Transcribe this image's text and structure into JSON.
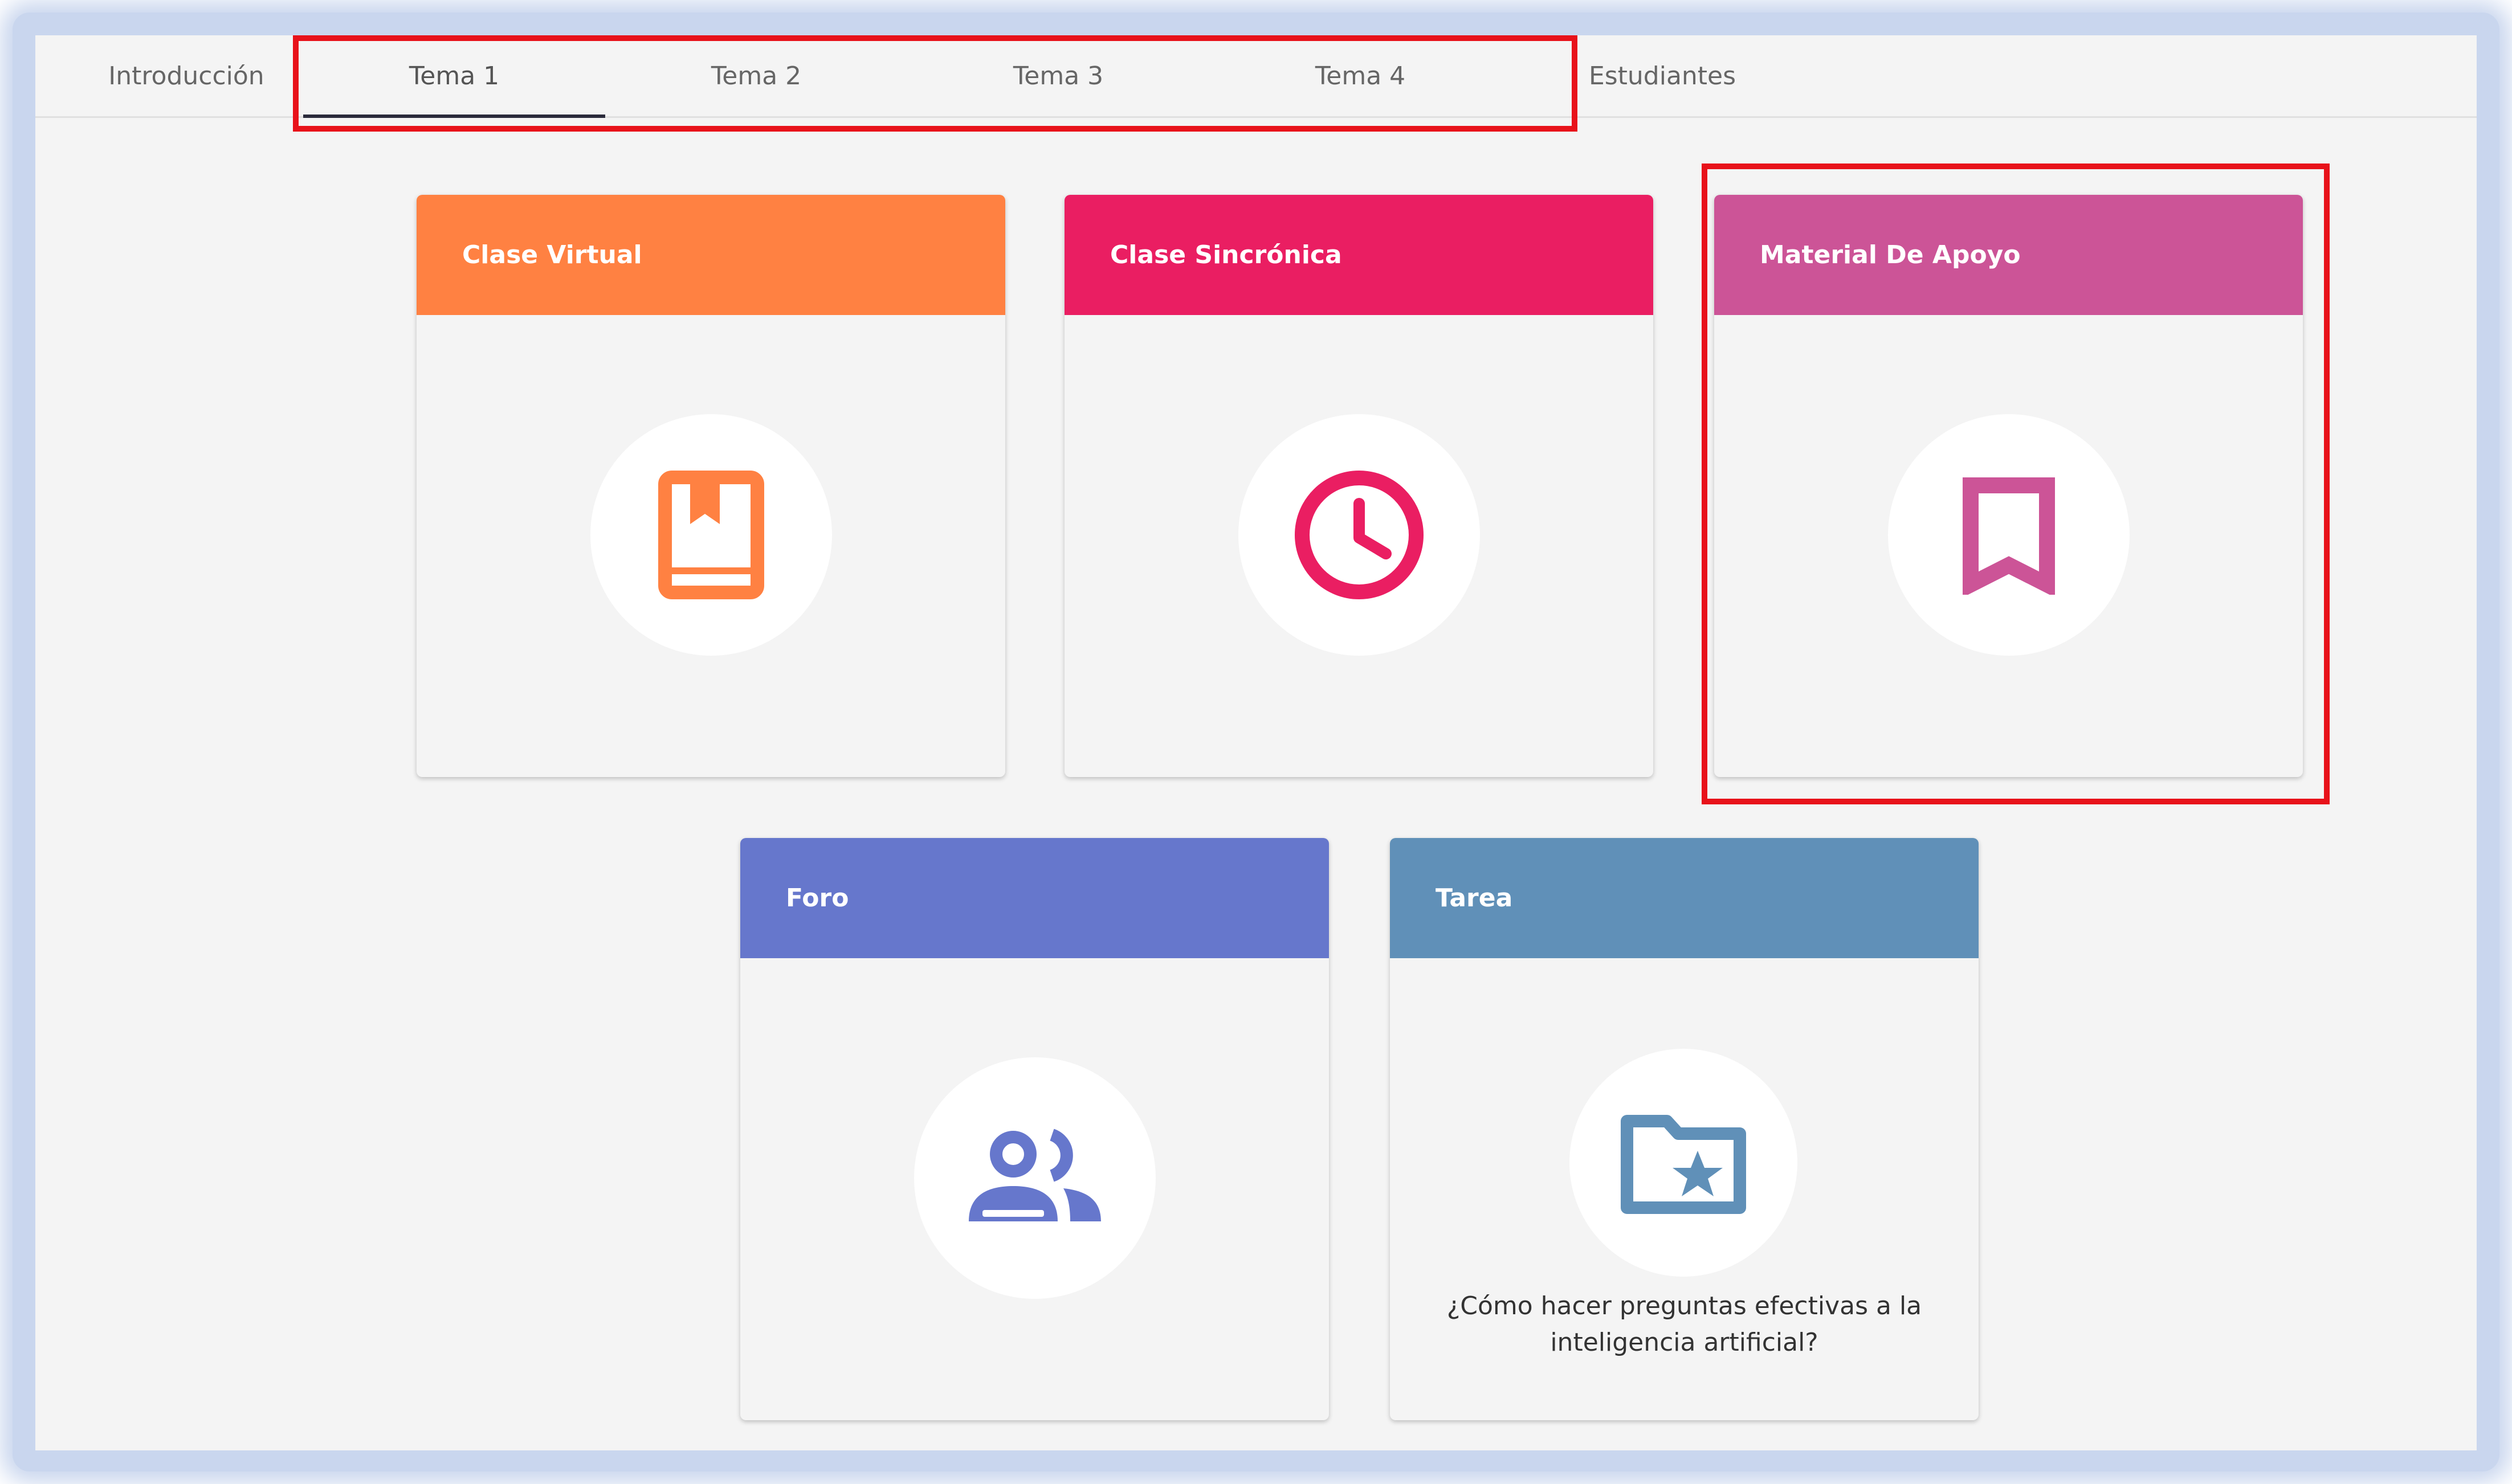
{
  "tabs": [
    {
      "label": "Introducción",
      "active": false
    },
    {
      "label": "Tema 1",
      "active": true
    },
    {
      "label": "Tema 2",
      "active": false
    },
    {
      "label": "Tema 3",
      "active": false
    },
    {
      "label": "Tema 4",
      "active": false
    },
    {
      "label": "Estudiantes",
      "active": false
    }
  ],
  "cards": [
    {
      "title": "Clase Virtual",
      "color": "#ff8142",
      "icon": "book-bookmark-icon"
    },
    {
      "title": "Clase Sincrónica",
      "color": "#ea1e62",
      "icon": "clock-icon"
    },
    {
      "title": "Material De Apoyo",
      "color": "#cc5497",
      "icon": "bookmark-icon"
    },
    {
      "title": "Foro",
      "color": "#6677cc",
      "icon": "people-icon"
    },
    {
      "title": "Tarea",
      "color": "#6090b8",
      "icon": "folder-star-icon",
      "caption": "¿Cómo hacer preguntas efectivas a la inteligencia artificial?"
    }
  ],
  "highlight_color": "#e8121a"
}
